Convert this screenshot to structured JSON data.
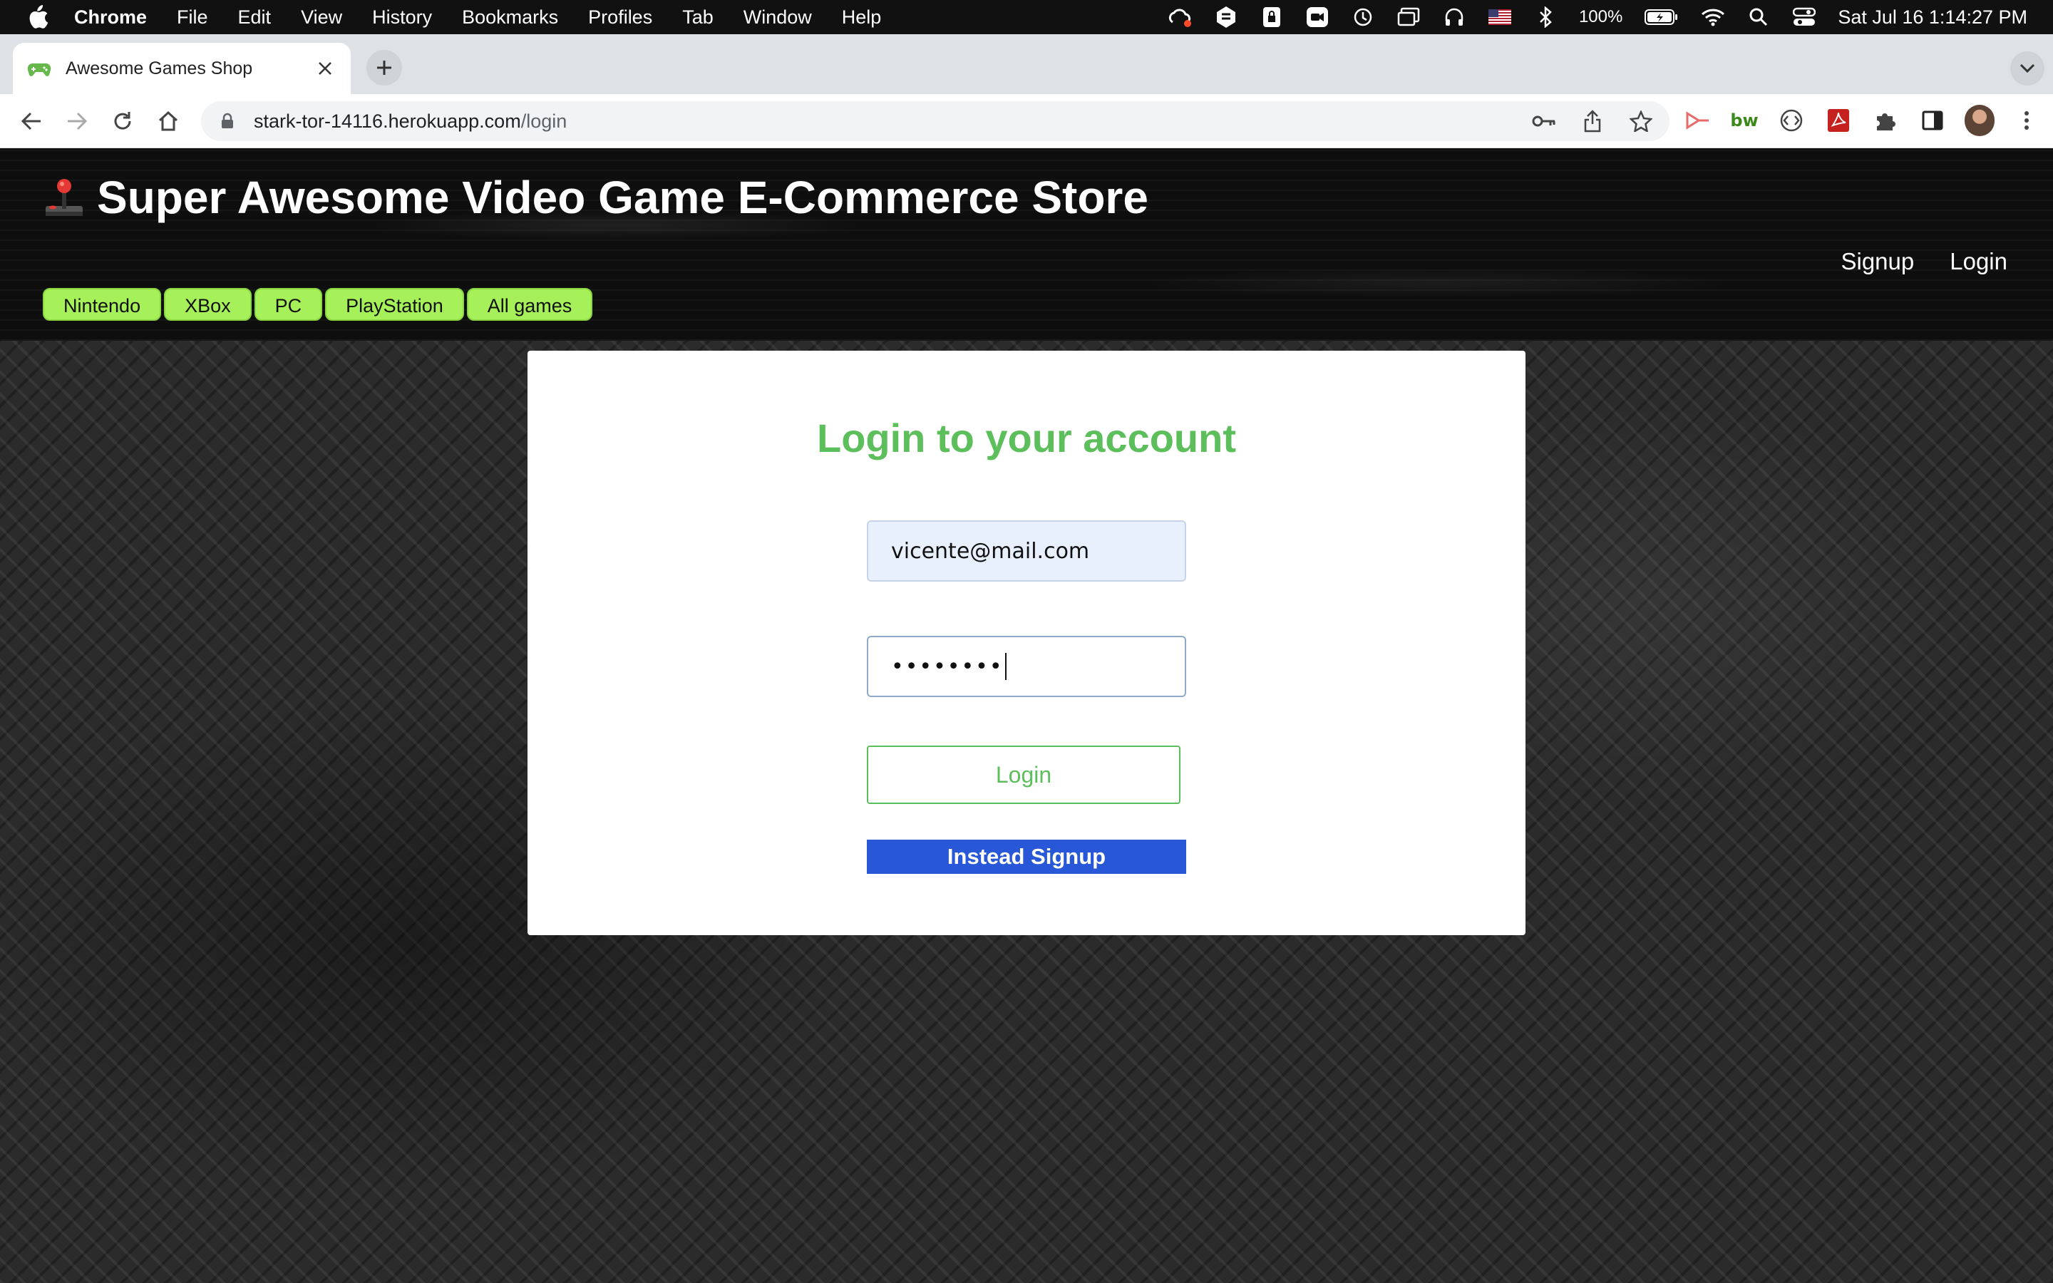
{
  "menubar": {
    "app_name": "Chrome",
    "items": [
      "File",
      "Edit",
      "View",
      "History",
      "Bookmarks",
      "Profiles",
      "Tab",
      "Window",
      "Help"
    ],
    "battery": "100%",
    "clock": "Sat Jul 16  1:14:27 PM"
  },
  "browser": {
    "tab_title": "Awesome Games Shop",
    "url_host": "stark-tor-14116.herokuapp.com",
    "url_path": "/login",
    "extension_bw_label": "bw"
  },
  "site": {
    "title": "Super Awesome Video Game E-Commerce Store",
    "auth_links": {
      "signup": "Signup",
      "login": "Login"
    },
    "platforms": [
      "Nintendo",
      "XBox",
      "PC",
      "PlayStation",
      "All games"
    ],
    "accent_green": "#a6f05a"
  },
  "login_form": {
    "heading": "Login to your account",
    "email_value": "vicente@mail.com",
    "password_value": "••••••••",
    "login_button": "Login",
    "signup_button": "Instead Signup",
    "heading_color": "#5cbf5c",
    "signup_color": "#2858d8"
  }
}
